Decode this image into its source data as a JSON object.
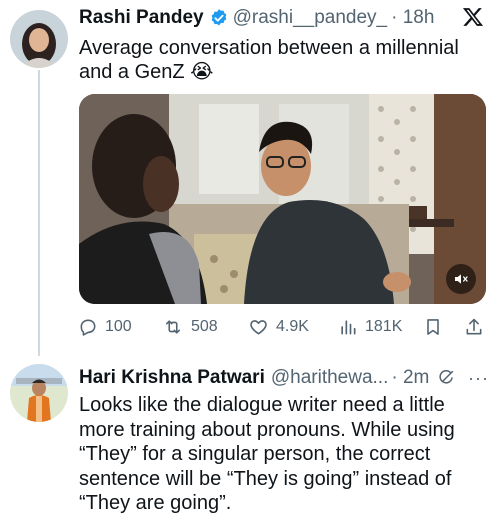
{
  "tweet": {
    "author_name": "Rashi Pandey",
    "handle": "@rashi__pandey_",
    "time": "· 18h",
    "text": "Average conversation between a millennial and a GenZ 😭",
    "stats": {
      "replies": "100",
      "retweets": "508",
      "likes": "4.9K",
      "views": "181K"
    }
  },
  "reply": {
    "author_name": "Hari Krishna Patwari",
    "handle": "@harithewa...",
    "time": "· 2m",
    "text": "Looks like the dialogue writer need a little more training about pronouns. While using “They” for a singular person, the correct sentence will be “They is going” instead of “They are going”.",
    "more": "···"
  },
  "colors": {
    "verified_blue": "#1d9bf0",
    "secondary_text": "#536471",
    "thread_line": "#cfd9de"
  }
}
